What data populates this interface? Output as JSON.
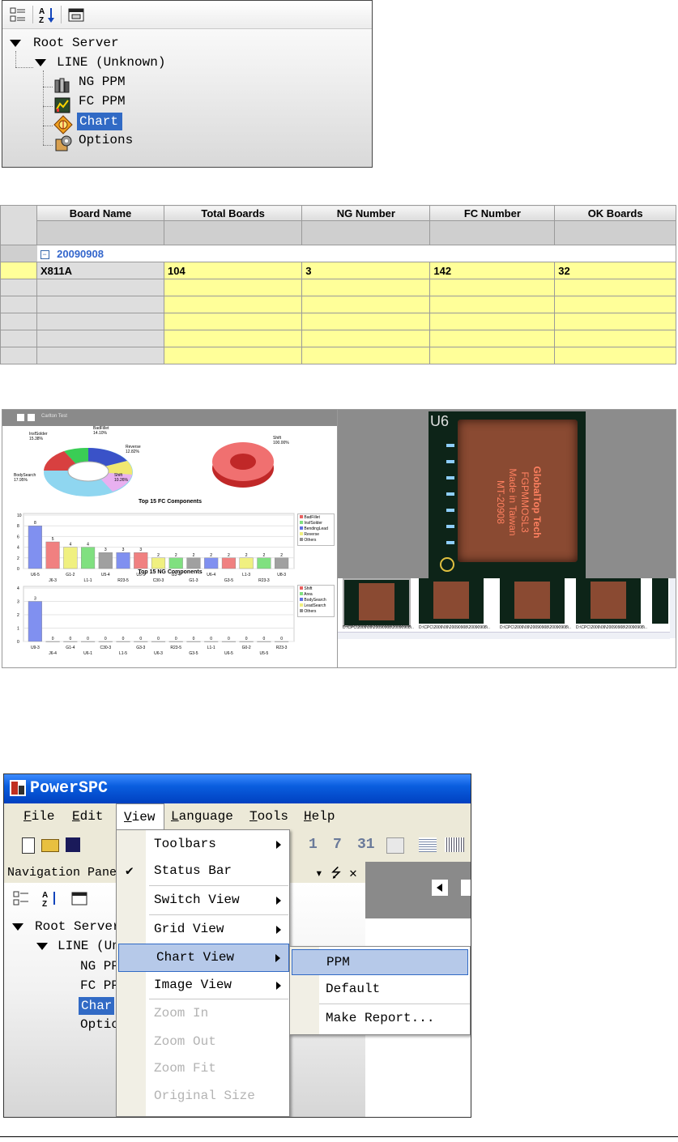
{
  "tree_panel": {
    "nodes": {
      "root": "Root Server",
      "line": "LINE (Unknown)",
      "ng_ppm": "NG PPM",
      "fc_ppm": "FC PPM",
      "chart": "Chart",
      "options": "Options"
    }
  },
  "grid": {
    "columns": [
      "Board Name",
      "Total Boards",
      "NG Number",
      "FC Number",
      "OK Boards"
    ],
    "group": "20090908",
    "rows": [
      [
        "X811A",
        "104",
        "3",
        "142",
        "32"
      ]
    ]
  },
  "charts": {
    "header_text": "Carlton Test",
    "pie1_labels": [
      "BadFillet\n14.10%",
      "InsfSolder\n15.38%",
      "Reverse\n12.82%",
      "Shift\n10.26%",
      "BodySearch\n17.95%"
    ],
    "pie2_label": "Shift\n100.00%",
    "fc_title": "Top 15 FC Components",
    "fc_legend": [
      "BadFillet",
      "InsfSolder",
      "BendingLead",
      "Reverse",
      "Others"
    ],
    "ng_title": "Top 15 NG Components",
    "ng_legend": [
      "Shift",
      "Area",
      "BodySearch",
      "LeadSearch",
      "Others"
    ]
  },
  "chart_data": [
    {
      "type": "bar",
      "title": "Top 15 FC Components",
      "categories": [
        "U6-5",
        "J6-3",
        "G1-2",
        "L1-1",
        "U5-4",
        "R23-5",
        "U5-5",
        "C30-3",
        "G3-4",
        "G1-3",
        "U6-4",
        "G3-5",
        "L1-3",
        "R23-3",
        "U8-3"
      ],
      "values": [
        8,
        5,
        4,
        4,
        3,
        3,
        3,
        2,
        2,
        2,
        2,
        2,
        2,
        2,
        2
      ],
      "ylim": [
        0,
        10
      ]
    },
    {
      "type": "bar",
      "title": "Top 15 NG Components",
      "categories": [
        "U9-3",
        "J6-4",
        "G1-4",
        "U6-1",
        "C30-3",
        "L1-5",
        "G3-3",
        "U6-3",
        "R23-5",
        "G3-5",
        "L1-1",
        "U6-5",
        "G0-2",
        "U5-5",
        "R23-3"
      ],
      "values": [
        3,
        0,
        0,
        0,
        0,
        0,
        0,
        0,
        0,
        0,
        0,
        0,
        0,
        0,
        0
      ],
      "ylim": [
        0,
        4
      ]
    }
  ],
  "image_panel": {
    "ref": "U6",
    "chip_text": [
      "GlobalTop Tech",
      "FGPMMOSL3",
      "Made in Taiwan",
      "MT-20908"
    ],
    "thumb_caption": "D:\\CPC\\2009\\09\\20090908\\20090908\\..."
  },
  "app": {
    "title": "PowerSPC",
    "menus": [
      "File",
      "Edit",
      "View",
      "Language",
      "Tools",
      "Help"
    ],
    "nav_title": "Navigation Pane",
    "nav_controls": "▾ ⭍ ✕",
    "view_menu": [
      "Toolbars",
      "Status Bar",
      "Switch View",
      "Grid View",
      "Chart View",
      "Image View",
      "Zoom In",
      "Zoom Out",
      "Zoom Fit",
      "Original Size"
    ],
    "chart_submenu": [
      "PPM",
      "Default",
      "Make Report..."
    ],
    "toolbar_nums": [
      "1",
      "7",
      "31"
    ],
    "tree_partial": [
      "Root Server",
      "LINE (Un",
      "NG PP",
      "FC PP",
      "Char",
      "Optio"
    ]
  },
  "colors": {
    "select_blue": "#316ac5",
    "grid_yellow": "#ffff99",
    "menu_hover": "#b6c9e9",
    "title_blue": "#0a5edf"
  }
}
